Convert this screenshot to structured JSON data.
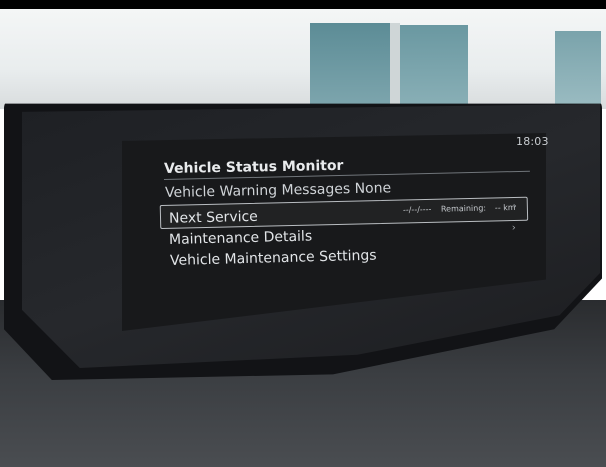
{
  "status_bar": {
    "time": "18:03"
  },
  "screen": {
    "title": "Vehicle Status Monitor",
    "warning_row": {
      "label": "Vehicle Warning Messages None"
    },
    "next_service": {
      "label": "Next Service",
      "date": "--/--/----",
      "remaining_label": "Remaining:",
      "remaining_value": "-- km",
      "chevron_icon": "chevron-right-icon"
    },
    "maintenance_details": {
      "label": "Maintenance Details",
      "chevron_icon": "chevron-right-icon"
    },
    "maintenance_settings": {
      "label": "Vehicle Maintenance Settings"
    }
  }
}
